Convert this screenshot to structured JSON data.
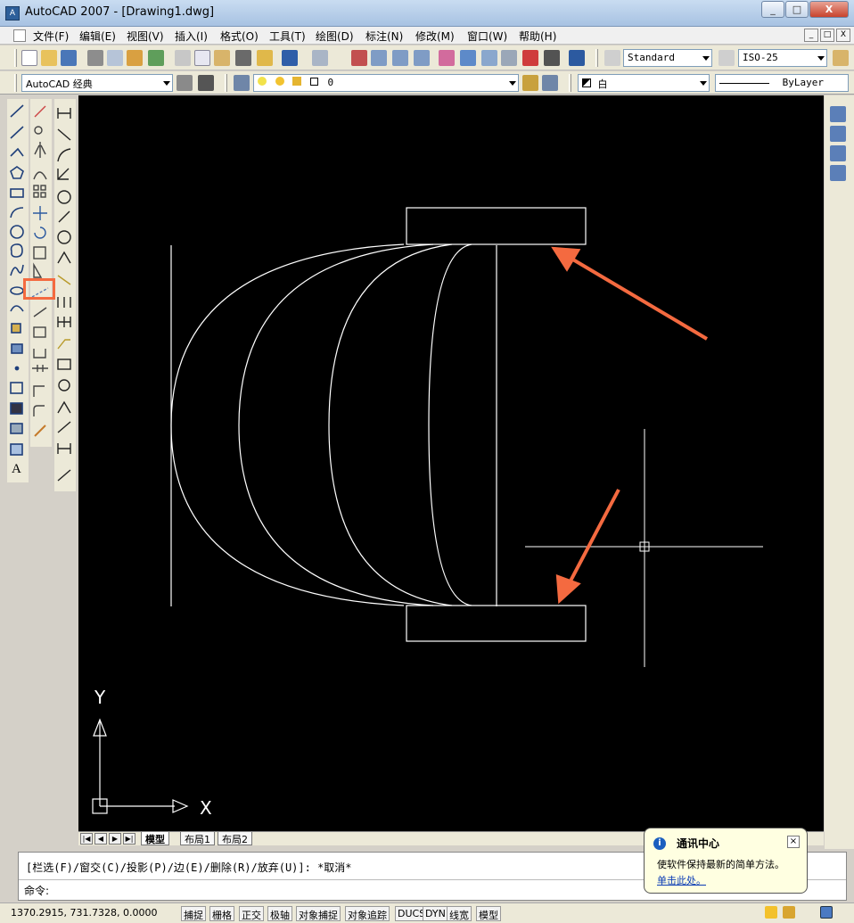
{
  "window": {
    "title": "AutoCAD 2007 - [Drawing1.dwg]",
    "min_label": "_",
    "max_label": "□",
    "close_label": "X"
  },
  "menu": [
    "文件(F)",
    "编辑(E)",
    "视图(V)",
    "插入(I)",
    "格式(O)",
    "工具(T)",
    "绘图(D)",
    "标注(N)",
    "修改(M)",
    "窗口(W)",
    "帮助(H)"
  ],
  "toolbar": {
    "text_style": "Standard",
    "dim_style": "ISO-25",
    "workspace": "AutoCAD 经典",
    "layer": "0",
    "color": "白",
    "linetype": "ByLayer"
  },
  "ucs": {
    "y_label": "Y",
    "x_label": "X"
  },
  "tabs": [
    "模型",
    "布局1",
    "布局2"
  ],
  "command": {
    "history": "[栏选(F)/窗交(C)/投影(P)/边(E)/删除(R)/放弃(U)]:  *取消*",
    "prompt": "命令:"
  },
  "status": {
    "coords": "1370.2915, 731.7328, 0.0000",
    "buttons": [
      "捕捉",
      "栅格",
      "正交",
      "极轴",
      "对象捕捉",
      "对象追踪",
      "DUCS",
      "DYN",
      "线宽",
      "模型"
    ]
  },
  "balloon": {
    "title": "通讯中心",
    "close_label": "×",
    "text": "使软件保持最新的简单方法。",
    "link": "单击此处。"
  },
  "colors": {
    "canvas": "#000000",
    "annotation": "#f46a40",
    "lines": "#ffffff"
  }
}
